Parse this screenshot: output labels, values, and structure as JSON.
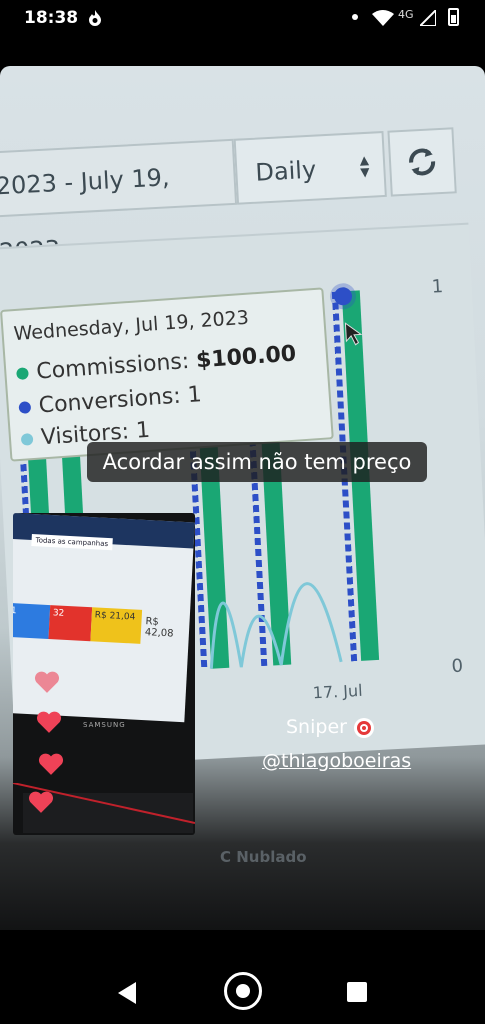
{
  "status_bar": {
    "time": "18:38",
    "network": "4G"
  },
  "dashboard": {
    "date_range": "2023 - July 19, 2023",
    "period": "Daily",
    "y_tick_top": "1",
    "y_tick_bottom": "0",
    "x_tick": "17. Jul"
  },
  "tooltip": {
    "date": "Wednesday, Jul 19, 2023",
    "commissions_label": "Commissions:",
    "commissions_value": "$100.00",
    "conversions": "Conversions: 1",
    "visitors": "Visitors: 1"
  },
  "story": {
    "caption": "Acordar assim não tem preço",
    "sniper": "Sniper",
    "handle": "@thiagoboeiras"
  },
  "inset": {
    "tab_label": "Todas as campanhas",
    "card_1": "1",
    "card_2": "32",
    "card_3": "R$ 21,04",
    "value": "R$ 42,08",
    "brand": "SAMSUNG"
  },
  "taskbar": {
    "weather": "C Nublado"
  },
  "colors": {
    "commissions": "#1aa774",
    "conversions": "#2d4fc7",
    "visitors": "#7fc8d8",
    "heart": "#ef4257"
  }
}
